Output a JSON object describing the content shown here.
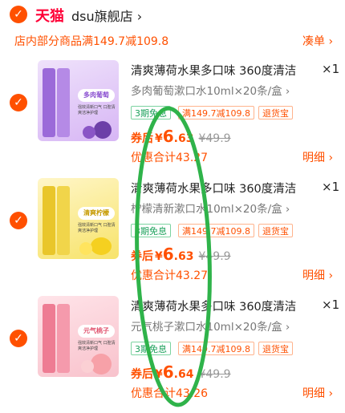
{
  "header": {
    "brand": "天猫",
    "shop_name": "dsu旗舰店",
    "chevron": "›"
  },
  "promo": {
    "text": "店内部分商品满149.7减109.8",
    "action": "凑单 ›"
  },
  "items": [
    {
      "title": "清爽薄荷水果多口味 360度清洁",
      "qty": "×1",
      "sku": "多肉葡萄漱口水10ml×20条/盒 ›",
      "tags": [
        "3期免息",
        "满149.7减109.8",
        "退货宝"
      ],
      "price_label": "券后",
      "price_currency": "¥",
      "price_int": "6",
      "price_dec": ".63",
      "price_orig": "¥49.9",
      "total": "优惠合计43.27",
      "detail": "明细 ›",
      "flavor_label": "多肉葡萄",
      "flavor_sub": "强效清新口气 口腔清爽洁净护理",
      "theme": "#d7b6f5"
    },
    {
      "title": "清爽薄荷水果多口味 360度清洁",
      "qty": "×1",
      "sku": "柠檬清新漱口水10ml×20条/盒 ›",
      "tags": [
        "3期免息",
        "满149.7减109.8",
        "退货宝"
      ],
      "price_label": "券后",
      "price_currency": "¥",
      "price_int": "6",
      "price_dec": ".63",
      "price_orig": "¥49.9",
      "total": "优惠合计43.27",
      "detail": "明细 ›",
      "flavor_label": "清爽柠檬",
      "flavor_sub": "强效清新口气 口腔清爽洁净护理",
      "theme": "#f7e36a"
    },
    {
      "title": "清爽薄荷水果多口味 360度清洁",
      "qty": "×1",
      "sku": "元气桃子漱口水10ml×20条/盒 ›",
      "tags": [
        "3期免息",
        "满149.7减109.8",
        "退货宝"
      ],
      "price_label": "券后",
      "price_currency": "¥",
      "price_int": "6",
      "price_dec": ".64",
      "price_orig": "¥49.9",
      "total": "优惠合计43.26",
      "detail": "明细 ›",
      "flavor_label": "元气桃子",
      "flavor_sub": "强效清新口气 口腔清爽洁净护理",
      "theme": "#f8c2cc"
    }
  ],
  "colors": {
    "accent": "#ff5000",
    "tmall_red": "#ff0036",
    "green_tag": "#1aa05a",
    "annotation": "#2fb34a"
  }
}
